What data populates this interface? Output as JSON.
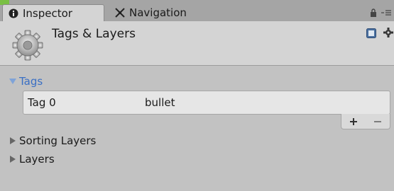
{
  "tabs": [
    {
      "label": "Inspector",
      "icon": "info-icon",
      "active": true
    },
    {
      "label": "Navigation",
      "icon": "navigation-icon",
      "active": false
    }
  ],
  "header": {
    "title": "Tags & Layers",
    "icon": "gear-icon"
  },
  "sections": {
    "tags": {
      "label": "Tags",
      "expanded": true,
      "items": [
        {
          "label": "Tag 0",
          "value": "bullet"
        }
      ]
    },
    "sorting_layers": {
      "label": "Sorting Layers",
      "expanded": false
    },
    "layers": {
      "label": "Layers",
      "expanded": false
    }
  },
  "footer": {
    "add_icon": "plus-icon",
    "remove_icon": "minus-icon"
  },
  "colors": {
    "accent": "#79bf43",
    "selected_section": "#3a6fc4",
    "panel": "#d4d4d4",
    "body": "#c2c2c2"
  }
}
